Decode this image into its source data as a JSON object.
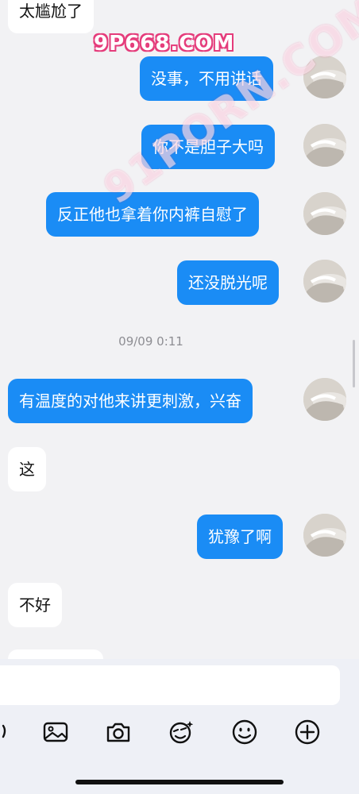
{
  "watermark": {
    "top": "9P668.COM",
    "diagonal": "91PORN.COM"
  },
  "messages": [
    {
      "text": "太尴尬了",
      "direction": "in"
    },
    {
      "text": "没事，不用讲话",
      "direction": "out"
    },
    {
      "text": "你不是胆子大吗",
      "direction": "out"
    },
    {
      "text": "反正他也拿着你内裤自慰了",
      "direction": "out"
    },
    {
      "text": "还没脱光呢",
      "direction": "out"
    },
    {
      "text": "有温度的对他来讲更刺激，兴奋",
      "direction": "out"
    },
    {
      "text": "这",
      "direction": "in"
    },
    {
      "text": "犹豫了啊",
      "direction": "out"
    },
    {
      "text": "不好",
      "direction": "in"
    },
    {
      "text": "",
      "direction": "in"
    }
  ],
  "timestamp": "09/09 0:11",
  "toolbar": {
    "icons": [
      "image-icon",
      "camera-icon",
      "sticker-icon",
      "emoji-icon",
      "plus-icon"
    ]
  },
  "colors": {
    "out_bubble": "#1a8cf5",
    "in_bubble": "#ffffff",
    "background": "#f2f2f4"
  }
}
